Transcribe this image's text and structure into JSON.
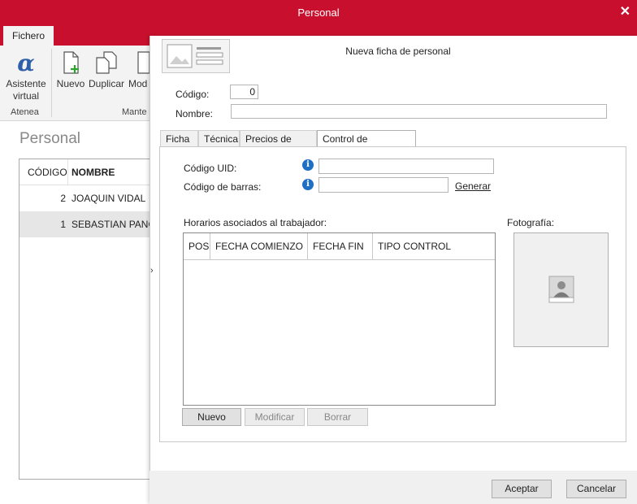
{
  "window": {
    "title": "Personal",
    "close_glyph": "✕"
  },
  "ribbon": {
    "tab": "Fichero",
    "buttons": {
      "asistente": "Asistente virtual",
      "nuevo": "Nuevo",
      "duplicar": "Duplicar",
      "modificar": "Mod"
    },
    "groups": {
      "atenea": "Atenea",
      "mantenimiento": "Mante"
    }
  },
  "list": {
    "title": "Personal",
    "columns": [
      "CÓDIGO",
      "NOMBRE"
    ],
    "rows": [
      {
        "codigo": "2",
        "nombre": "JOAQUIN VIDAL"
      },
      {
        "codigo": "1",
        "nombre": "SEBASTIAN PANCO"
      }
    ]
  },
  "dialog": {
    "title": "Nueva ficha de personal",
    "codigo_label": "Código:",
    "codigo_value": "0",
    "nombre_label": "Nombre:",
    "nombre_value": "",
    "tabs": [
      "Ficha",
      "Técnica",
      "Precios de horas",
      "Control de presencia"
    ],
    "active_tab": "Control de presencia",
    "uid_label": "Código UID:",
    "uid_value": "",
    "barras_label": "Código de barras:",
    "barras_value": "",
    "generar": "Generar",
    "horarios_label": "Horarios asociados al trabajador:",
    "horarios_columns": [
      "POS",
      "FECHA COMIENZO",
      "FECHA FIN",
      "TIPO CONTROL"
    ],
    "buttons": {
      "nuevo": "Nuevo",
      "modificar": "Modificar",
      "borrar": "Borrar"
    },
    "foto_label": "Fotografía:",
    "aceptar": "Aceptar",
    "cancelar": "Cancelar"
  },
  "colors": {
    "accent": "#c8102e",
    "info": "#1f6fc5"
  },
  "icons": [
    "close-icon",
    "alpha-icon",
    "new-document-icon",
    "duplicate-icon",
    "info-icon",
    "person-photo-icon",
    "photo-placeholder-icon",
    "chevron-right-icon"
  ]
}
